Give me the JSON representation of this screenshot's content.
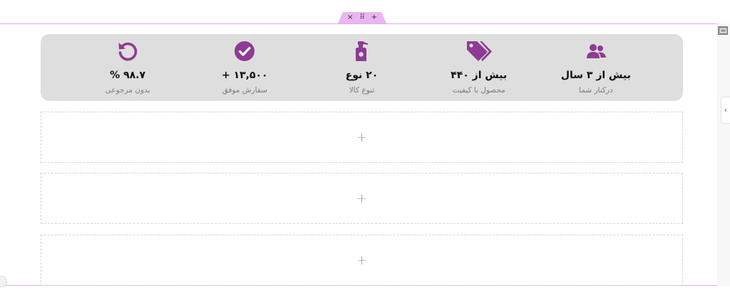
{
  "editor": {
    "handle": {
      "close": "×",
      "drag": "⠿",
      "add": "+"
    },
    "right_toggle": "‹"
  },
  "colors": {
    "accent": "#8e3b93",
    "bar_bg": "#dedede",
    "outline": "#e0a8e8"
  },
  "features": [
    {
      "icon": "users-icon",
      "title": "بیش از ۳ سال",
      "subtitle": "درکنار شما"
    },
    {
      "icon": "tags-icon",
      "title": "بیش از ۴۴۰",
      "subtitle": "محصول با کیفیت"
    },
    {
      "icon": "spray-bottle-icon",
      "title": "۲۰ نوع",
      "subtitle": "تنوع کالا"
    },
    {
      "icon": "check-circle-icon",
      "title": "۱۳,۵۰۰ +",
      "subtitle": "سفارش موفق"
    },
    {
      "icon": "undo-icon",
      "title": "۹۸.۷ %",
      "subtitle": "بدون مرجوعی"
    }
  ],
  "drop_zones": [
    "+",
    "+",
    "+"
  ]
}
